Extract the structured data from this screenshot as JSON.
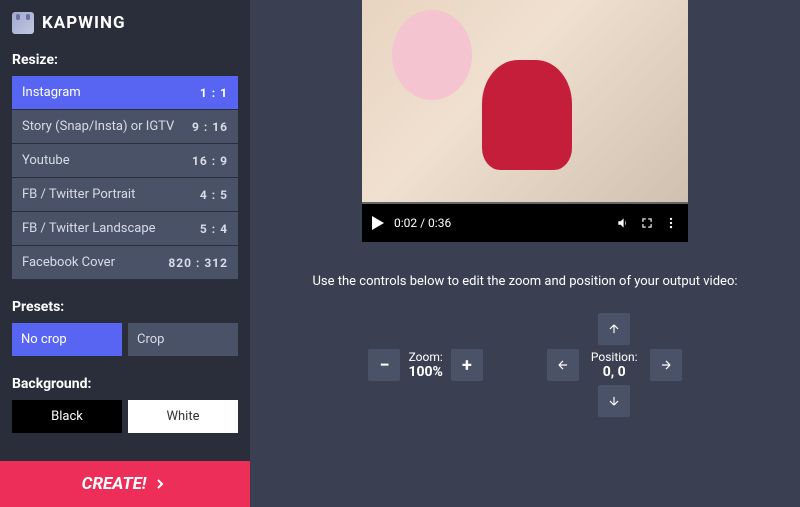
{
  "brand": "KAPWING",
  "sidebar": {
    "resize_label": "Resize:",
    "resize_items": [
      {
        "label": "Instagram",
        "ratio": "1 : 1"
      },
      {
        "label": "Story (Snap/Insta) or IGTV",
        "ratio": "9 : 16"
      },
      {
        "label": "Youtube",
        "ratio": "16 : 9"
      },
      {
        "label": "FB / Twitter Portrait",
        "ratio": "4 : 5"
      },
      {
        "label": "FB / Twitter Landscape",
        "ratio": "5 : 4"
      },
      {
        "label": "Facebook Cover",
        "ratio": "820 : 312"
      }
    ],
    "presets_label": "Presets:",
    "presets": {
      "nocrop": "No crop",
      "crop": "Crop"
    },
    "background_label": "Background:",
    "background": {
      "black": "Black",
      "white": "White"
    },
    "create": "CREATE!"
  },
  "video": {
    "time": "0:02 / 0:36"
  },
  "help_text": "Use the controls below to edit the zoom and position of your output video:",
  "zoom": {
    "label": "Zoom:",
    "value": "100%",
    "minus": "−",
    "plus": "+"
  },
  "position": {
    "label": "Position:",
    "value": "0, 0"
  }
}
